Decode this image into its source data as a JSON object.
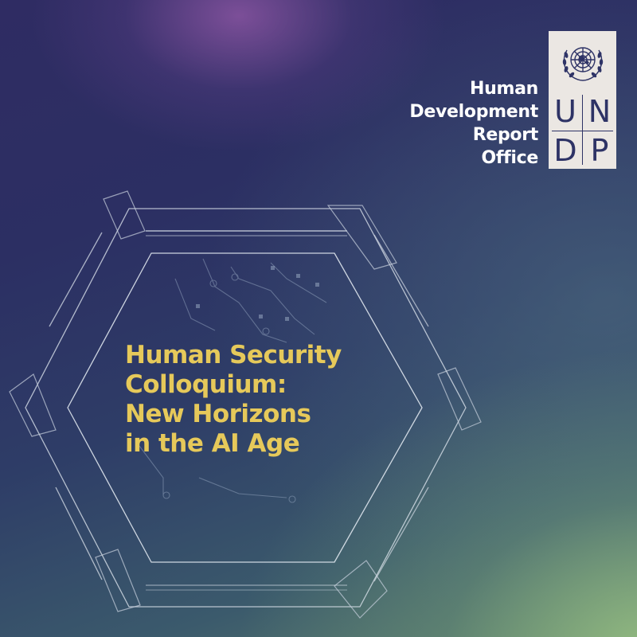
{
  "office": {
    "lines": [
      "Human",
      "Development",
      "Report",
      "Office"
    ]
  },
  "logo": {
    "emblem": "un-emblem-icon",
    "letters": [
      "U",
      "N",
      "D",
      "P"
    ]
  },
  "title": {
    "lines": [
      "Human Security",
      "Colloquium:",
      "New Horizons",
      "in the AI Age"
    ]
  },
  "colors": {
    "title": "#e6c95a",
    "logo_bg": "#ebe7e3",
    "logo_ink": "#2e3366",
    "office_text": "#ffffff",
    "background_top": "#2f2c63",
    "background_corner": "#96be82"
  }
}
